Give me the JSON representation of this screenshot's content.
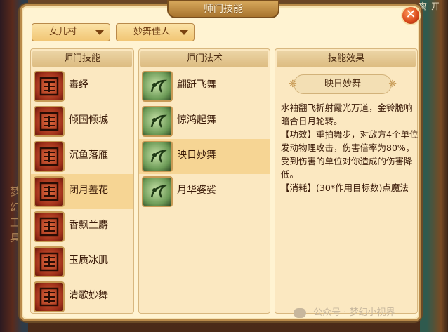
{
  "window": {
    "title": "师门技能",
    "top_right": "离开"
  },
  "filters": {
    "school": "女儿村",
    "skill": "妙舞佳人"
  },
  "columns": {
    "skills": "师门技能",
    "spells": "师门法术",
    "effects": "技能效果"
  },
  "skills": [
    {
      "label": "毒经",
      "icon": "poison-sutra-icon",
      "selected": false
    },
    {
      "label": "倾国倾城",
      "icon": "peerless-beauty-icon",
      "selected": false
    },
    {
      "label": "沉鱼落雁",
      "icon": "fish-sink-icon",
      "selected": false
    },
    {
      "label": "闭月羞花",
      "icon": "moon-hide-icon",
      "selected": true
    },
    {
      "label": "香飘兰麝",
      "icon": "orchid-scent-icon",
      "selected": false
    },
    {
      "label": "玉质冰肌",
      "icon": "jade-ice-icon",
      "selected": false
    },
    {
      "label": "清歌妙舞",
      "icon": "clear-song-icon",
      "selected": false
    }
  ],
  "spells": [
    {
      "label": "翩跹飞舞",
      "icon": "flying-dance-icon",
      "selected": false
    },
    {
      "label": "惊鸿起舞",
      "icon": "swan-dance-icon",
      "selected": false
    },
    {
      "label": "映日妙舞",
      "icon": "sun-dance-icon",
      "selected": true
    },
    {
      "label": "月华婆娑",
      "icon": "moon-grace-icon",
      "selected": false
    }
  ],
  "effect": {
    "name": "映日妙舞",
    "desc": "水袖翻飞折射霞光万道，金铃脆响暗合日月轮转。",
    "power": "【功效】重拍舞步，对敌方4个单位发动物理攻击，伤害倍率为80%，受到伤害的单位对你造成的伤害降低。",
    "cost": "【消耗】(30*作用目标数)点魔法"
  },
  "background": {
    "left_text": "梦幻工具"
  },
  "watermark": "公众号 · 梦幻小视界"
}
